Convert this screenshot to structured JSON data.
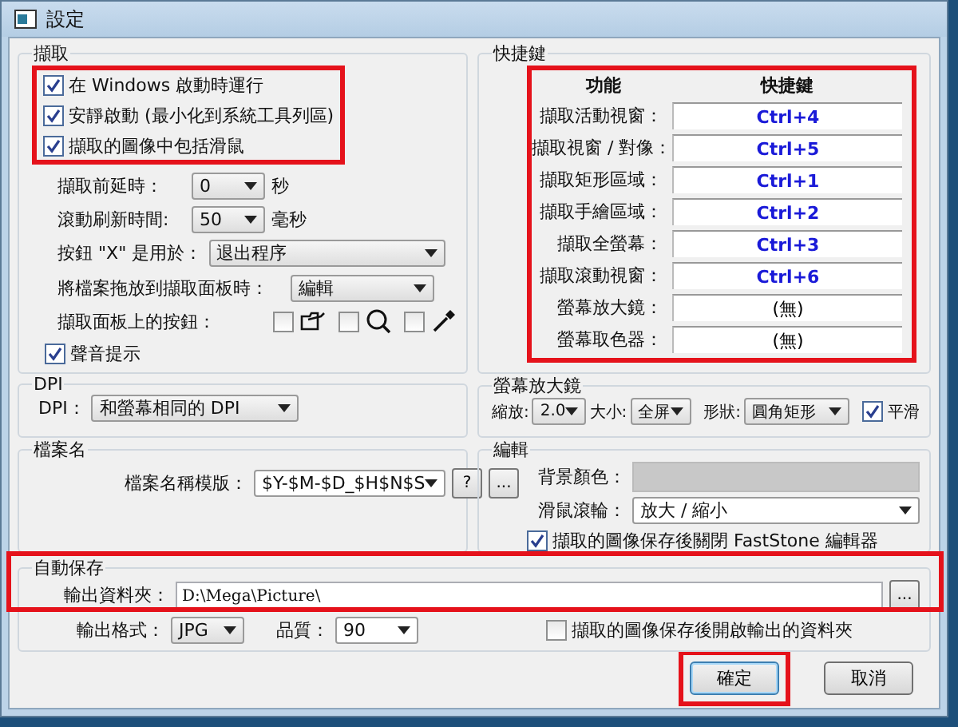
{
  "window": {
    "title": "設定"
  },
  "capture": {
    "title": "擷取",
    "highlighted": true,
    "checks": [
      {
        "label": "在 Windows 啟動時運行",
        "checked": true
      },
      {
        "label": "安靜啟動 (最小化到系統工具列區)",
        "checked": true
      },
      {
        "label": "擷取的圖像中包括滑鼠",
        "checked": true
      }
    ],
    "delay": {
      "label": "擷取前延時：",
      "value": "0",
      "unit": "秒"
    },
    "scroll": {
      "label": "滾動刷新時間:",
      "value": "50",
      "unit": "毫秒"
    },
    "close_button": {
      "label": "按鈕 \"X\" 是用於：",
      "value": "退出程序"
    },
    "drop": {
      "label": "將檔案拖放到擷取面板時：",
      "value": "編輯"
    },
    "panel_buttons": {
      "label": "擷取面板上的按鈕：",
      "items": [
        {
          "kind": "folder",
          "checked": false
        },
        {
          "kind": "search",
          "checked": false
        },
        {
          "kind": "eyedropper",
          "checked": false
        }
      ]
    },
    "sound": {
      "label": "聲音提示",
      "checked": true
    }
  },
  "hotkeys": {
    "title": "快捷鍵",
    "highlighted": true,
    "columns": [
      "功能",
      "快捷鍵"
    ],
    "rows": [
      {
        "function": "擷取活動視窗：",
        "key": "Ctrl+4",
        "assigned": true
      },
      {
        "function": "擷取視窗 / 對像：",
        "key": "Ctrl+5",
        "assigned": true
      },
      {
        "function": "擷取矩形區域：",
        "key": "Ctrl+1",
        "assigned": true
      },
      {
        "function": "擷取手繪區域：",
        "key": "Ctrl+2",
        "assigned": true
      },
      {
        "function": "擷取全螢幕：",
        "key": "Ctrl+3",
        "assigned": true
      },
      {
        "function": "擷取滾動視窗：",
        "key": "Ctrl+6",
        "assigned": true
      },
      {
        "function": "螢幕放大鏡：",
        "key": "(無)",
        "assigned": false
      },
      {
        "function": "螢幕取色器：",
        "key": "(無)",
        "assigned": false
      }
    ]
  },
  "dpi": {
    "title": "DPI",
    "label": "DPI：",
    "value": "和螢幕相同的 DPI"
  },
  "magnifier": {
    "title": "螢幕放大鏡",
    "zoom_label": "縮放:",
    "zoom": "2.0",
    "size_label": "大小:",
    "size": "全屏",
    "shape_label": "形狀:",
    "shape": "圓角矩形",
    "smooth": {
      "label": "平滑",
      "checked": true
    }
  },
  "filename": {
    "title": "檔案名",
    "label": "檔案名稱模版：",
    "value": "$Y-$M-$D_$H$N$S",
    "help": "?",
    "browse": "..."
  },
  "editor": {
    "title": "編輯",
    "bg_label": "背景顏色：",
    "wheel_label": "滑鼠滾輪：",
    "wheel": "放大 / 縮小",
    "close_after": {
      "label": "擷取的圖像保存後關閉 FastStone 編輯器",
      "checked": true
    }
  },
  "autosave": {
    "title": "自動保存",
    "highlighted": true,
    "folder_label": "輸出資料夾：",
    "folder": "D:\\Mega\\Picture\\",
    "browse": "...",
    "format_label": "輸出格式：",
    "format": "JPG",
    "quality_label": "品質：",
    "quality": "90",
    "open_after": {
      "label": "擷取的圖像保存後開啟輸出的資料夾",
      "checked": false
    }
  },
  "buttons": [
    {
      "label": "確定",
      "default": true,
      "highlighted": true
    },
    {
      "label": "取消",
      "default": false,
      "highlighted": false
    }
  ]
}
